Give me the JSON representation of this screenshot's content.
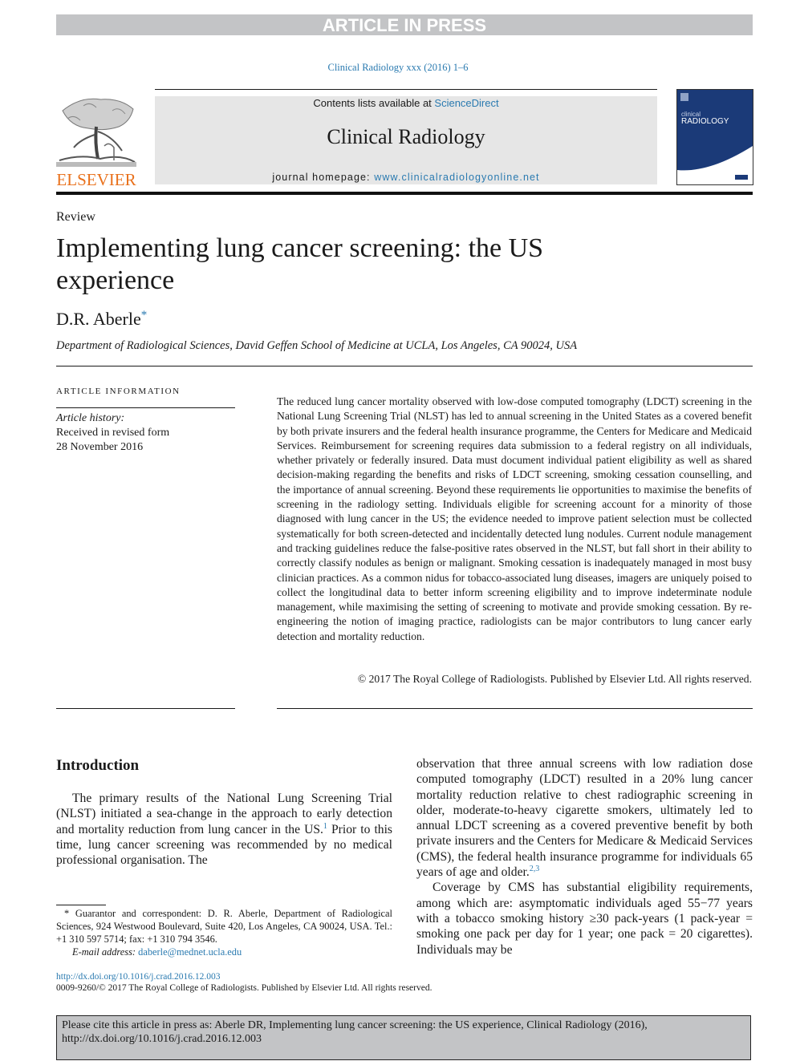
{
  "banner": {
    "text": "ARTICLE IN PRESS"
  },
  "journal_ref": "Clinical Radiology xxx (2016) 1–6",
  "masthead": {
    "publisher_logo_text": "ELSEVIER",
    "contents_prefix": "Contents lists available at ",
    "contents_link": "ScienceDirect",
    "journal_name": "Clinical Radiology",
    "homepage_prefix": "journal homepage: ",
    "homepage_link": "www.clinicalradiologyonline.net",
    "cover": {
      "title_small": "clinical",
      "title_large": "RADIOLOGY"
    }
  },
  "article": {
    "type": "Review",
    "title": "Implementing lung cancer screening: the US experience",
    "author": "D.R. Aberle",
    "author_mark": "*",
    "affiliation": "Department of Radiological Sciences, David Geffen School of Medicine at UCLA, Los Angeles, CA 90024, USA"
  },
  "article_info": {
    "heading": "ARTICLE INFORMATION",
    "history_label": "Article history:",
    "history_lines": [
      "Received in revised form",
      "28 November 2016"
    ]
  },
  "abstract": {
    "text": "The reduced lung cancer mortality observed with low-dose computed tomography (LDCT) screening in the National Lung Screening Trial (NLST) has led to annual screening in the United States as a covered benefit by both private insurers and the federal health insurance programme, the Centers for Medicare and Medicaid Services. Reimbursement for screening requires data submission to a federal registry on all individuals, whether privately or federally insured. Data must document individual patient eligibility as well as shared decision-making regarding the benefits and risks of LDCT screening, smoking cessation counselling, and the importance of annual screening. Beyond these requirements lie opportunities to maximise the benefits of screening in the radiology setting. Individuals eligible for screening account for a minority of those diagnosed with lung cancer in the US; the evidence needed to improve patient selection must be collected systematically for both screen-detected and incidentally detected lung nodules. Current nodule management and tracking guidelines reduce the false-positive rates observed in the NLST, but fall short in their ability to correctly classify nodules as benign or malignant. Smoking cessation is inadequately managed in most busy clinician practices. As a common nidus for tobacco-associated lung diseases, imagers are uniquely poised to collect the longitudinal data to better inform screening eligibility and to improve indeterminate nodule management, while maximising the setting of screening to motivate and provide smoking cessation. By re-engineering the notion of imaging practice, radiologists can be major contributors to lung cancer early detection and mortality reduction.",
    "copyright": "© 2017 The Royal College of Radiologists. Published by Elsevier Ltd. All rights reserved."
  },
  "body": {
    "intro_heading": "Introduction",
    "left_p1_a": "The primary results of the National Lung Screening Trial (NLST) initiated a sea-change in the approach to early detection and mortality reduction from lung cancer in the US.",
    "left_p1_ref": "1",
    "left_p1_b": " Prior to this time, lung cancer screening was recommended by no medical professional organisation. The",
    "right_p1_a": "observation that three annual screens with low radiation dose computed tomography (LDCT) resulted in a 20% lung cancer mortality reduction relative to chest radiographic screening in older, moderate-to-heavy cigarette smokers, ultimately led to annual LDCT screening as a covered preventive benefit by both private insurers and the Centers for Medicare & Medicaid Services (CMS), the federal health insurance programme for individuals 65 years of age and older.",
    "right_p1_ref": "2,3",
    "right_p2": "Coverage by CMS has substantial eligibility requirements, among which are: asymptomatic individuals aged 55−77 years with a tobacco smoking history ≥30 pack-years (1 pack-year = smoking one pack per day for 1 year; one pack = 20 cigarettes). Individuals may be"
  },
  "footnote": {
    "mark": "*",
    "text": " Guarantor and correspondent: D. R. Aberle, Department of Radiological Sciences, 924 Westwood Boulevard, Suite 420, Los Angeles, CA 90024, USA. Tel.: +1 310 597 5714; fax: +1 310 794 3546.",
    "email_label": "E-mail address: ",
    "email": "daberle@mednet.ucla.edu"
  },
  "doi_link": "http://dx.doi.org/10.1016/j.crad.2016.12.003",
  "issn_line": "0009-9260/© 2017 The Royal College of Radiologists. Published by Elsevier Ltd. All rights reserved.",
  "cite_box": "Please cite this article in press as: Aberle DR, Implementing lung cancer screening: the US experience, Clinical Radiology (2016), http://dx.doi.org/10.1016/j.crad.2016.12.003",
  "colors": {
    "link": "#2a7ab0",
    "elsevier_orange": "#e9711c",
    "banner_gray": "#c3c4c6",
    "masthead_gray": "#e6e6e6",
    "cover_blue": "#1b3a78"
  }
}
